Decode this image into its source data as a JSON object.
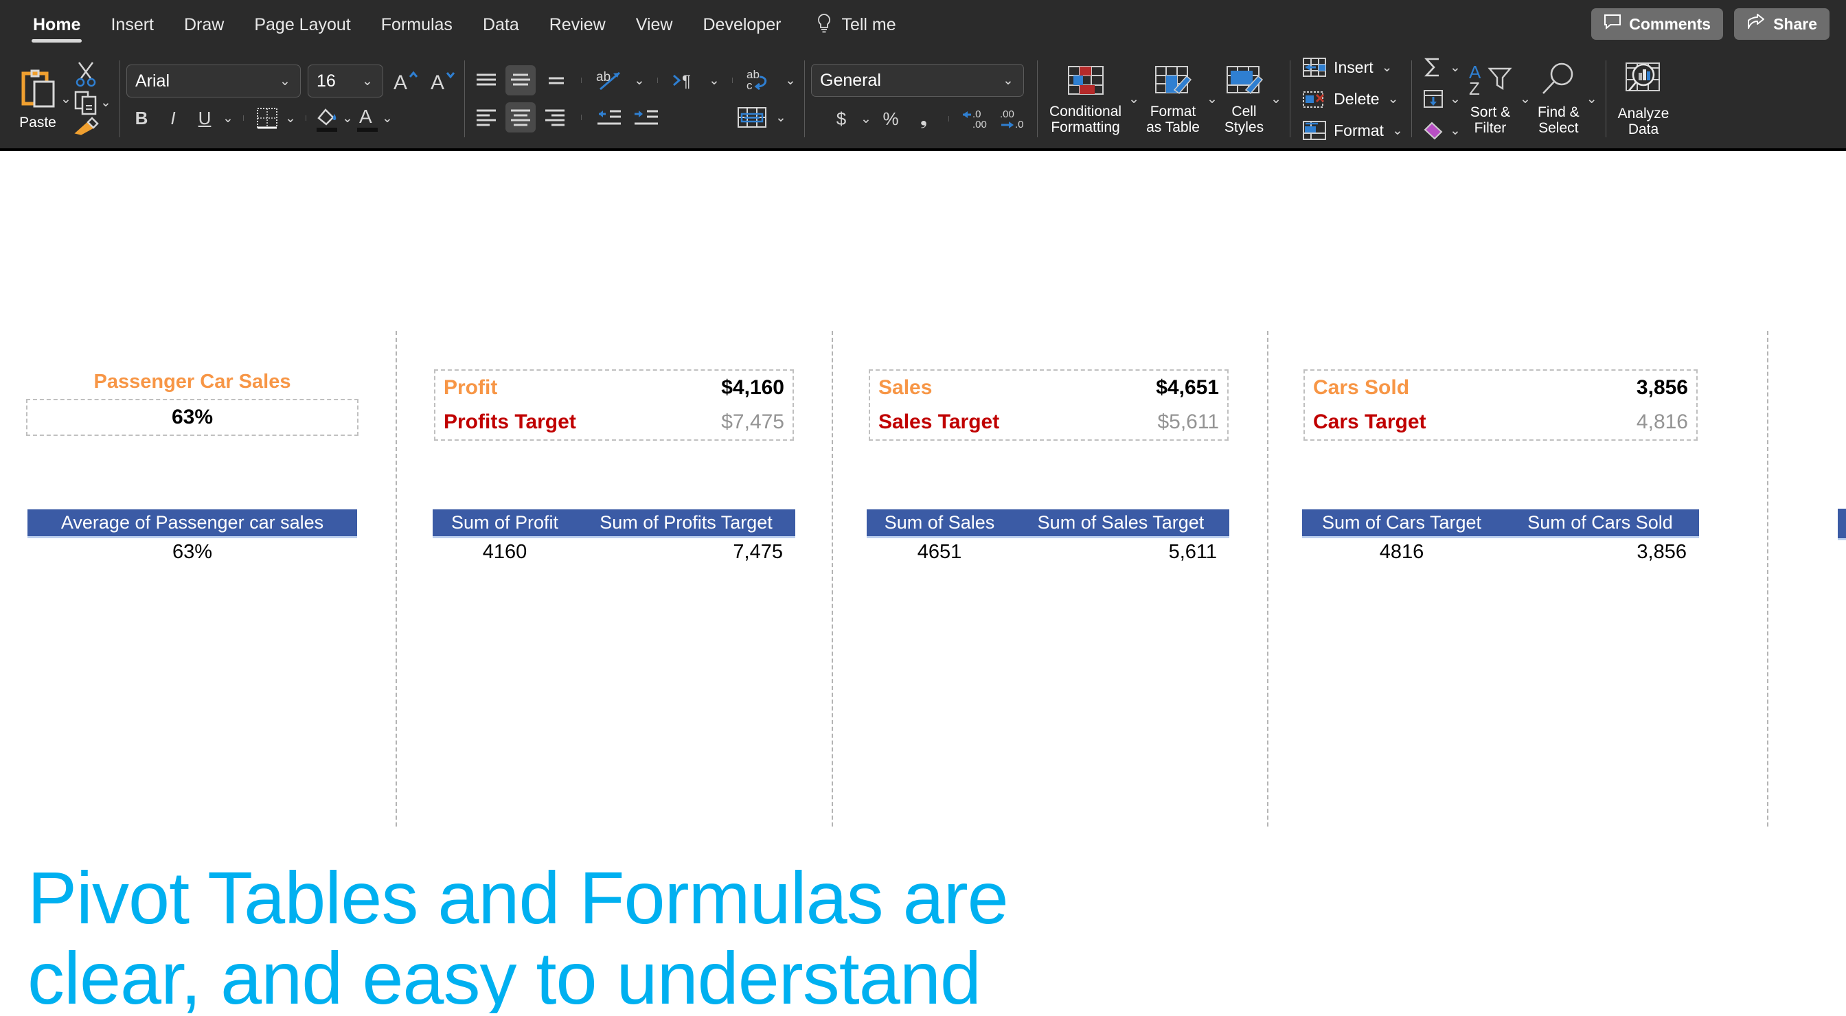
{
  "ribbon": {
    "tabs": [
      {
        "label": "Home",
        "active": true
      },
      {
        "label": "Insert",
        "active": false
      },
      {
        "label": "Draw",
        "active": false
      },
      {
        "label": "Page Layout",
        "active": false
      },
      {
        "label": "Formulas",
        "active": false
      },
      {
        "label": "Data",
        "active": false
      },
      {
        "label": "Review",
        "active": false
      },
      {
        "label": "View",
        "active": false
      },
      {
        "label": "Developer",
        "active": false
      }
    ],
    "tell_me": "Tell me",
    "comments": "Comments",
    "share": "Share",
    "clipboard": {
      "paste_label": "Paste"
    },
    "font": {
      "family_value": "Arial",
      "size_value": "16",
      "bold": "B",
      "italic": "I",
      "underline": "U"
    },
    "number": {
      "format_value": "General"
    },
    "styles": {
      "conditional_formatting": "Conditional\nFormatting",
      "format_as_table": "Format\nas Table",
      "cell_styles": "Cell\nStyles"
    },
    "cells": {
      "insert": "Insert",
      "delete": "Delete",
      "format": "Format"
    },
    "editing": {
      "sort_filter": "Sort &\nFilter",
      "find_select": "Find &\nSelect"
    },
    "analysis": {
      "analyze_data": "Analyze\nData"
    }
  },
  "sheet": {
    "cards": [
      {
        "id": "passenger-car-sales",
        "title": "Passenger Car Sales",
        "value": "63%",
        "type": "single"
      },
      {
        "id": "profit",
        "type": "pair",
        "primary_label": "Profit",
        "primary_value": "$4,160",
        "target_label": "Profits Target",
        "target_value": "$7,475"
      },
      {
        "id": "sales",
        "type": "pair",
        "primary_label": "Sales",
        "primary_value": "$4,651",
        "target_label": "Sales Target",
        "target_value": "$5,611"
      },
      {
        "id": "cars-sold",
        "type": "pair",
        "primary_label": "Cars Sold",
        "primary_value": "3,856",
        "target_label": "Cars Target",
        "target_value": "4,816"
      }
    ],
    "pivot_tables": [
      {
        "id": "pivot-passenger-car-sales",
        "headers": [
          "Average of Passenger car sales"
        ],
        "rows": [
          [
            "63%"
          ]
        ]
      },
      {
        "id": "pivot-profit",
        "headers": [
          "Sum of Profit",
          "Sum of Profits Target"
        ],
        "rows": [
          [
            "4160",
            "7,475"
          ]
        ]
      },
      {
        "id": "pivot-sales",
        "headers": [
          "Sum of Sales",
          "Sum of Sales Target"
        ],
        "rows": [
          [
            "4651",
            "5,611"
          ]
        ]
      },
      {
        "id": "pivot-cars",
        "headers": [
          "Sum of Cars Target",
          "Sum of Cars Sold"
        ],
        "rows": [
          [
            "4816",
            "3,856"
          ]
        ]
      }
    ],
    "annotation": "Pivot Tables and Formulas are\nclear, and easy to understand",
    "annotation_color": "#00b0f0"
  },
  "colors": {
    "ribbon_bg": "#2b2b2b",
    "kpi_orange": "#f79646",
    "kpi_red": "#c00000",
    "kpi_gray": "#949494",
    "pivot_header_bg": "#3b5ba5",
    "accent_blue": "#2f7fd1"
  }
}
